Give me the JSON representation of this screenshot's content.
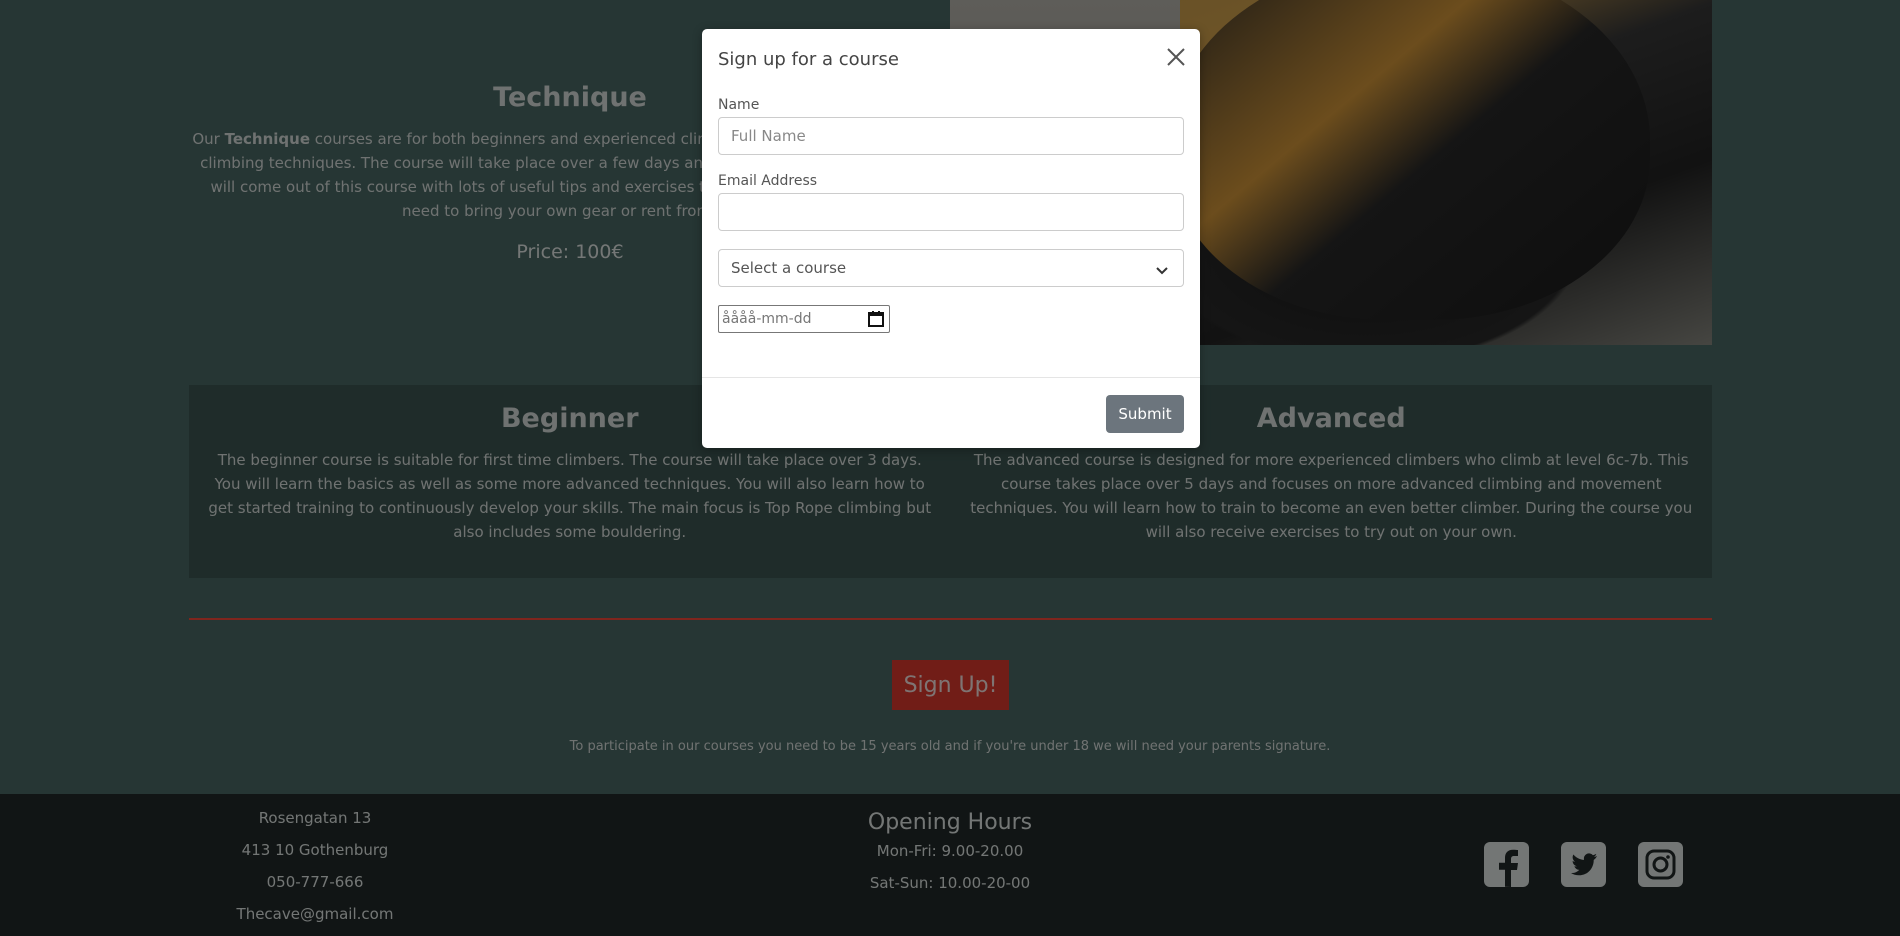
{
  "technique": {
    "title": "Technique",
    "desc_pre": "Our ",
    "desc_bold": "Technique",
    "desc_post": " courses are for both beginners and experienced climbers who want to improve their climbing techniques. The course will take place over a few days and is adapted to your needs. You will come out of this course with lots of useful tips and exercises to practice afterwards. You will need to bring your own gear or rent from us.",
    "price": "Price: 100€"
  },
  "beginner": {
    "title": "Beginner",
    "desc": "The beginner course is suitable for first time climbers. The course will take place over 3 days. You will learn the basics as well as some more advanced techniques. You will also learn how to get started training to continuously develop your skills. The main focus is Top Rope climbing but also includes some bouldering."
  },
  "advanced": {
    "title": "Advanced",
    "desc": "The advanced course is designed for more experienced climbers who climb at level 6c-7b. This course takes place over 5 days and focuses on more advanced climbing and movement techniques. You will learn how to train to become an even better climber. During the course you will also receive exercises to try out on your own."
  },
  "signup_button": "Sign Up!",
  "note": "To participate in our courses you need to be 15 years old and if you're under 18 we will need your parents signature.",
  "footer": {
    "address": [
      "Rosengatan 13",
      "413 10 Gothenburg",
      "050-777-666",
      "Thecave@gmail.com"
    ],
    "hours_title": "Opening Hours",
    "hours": [
      "Mon-Fri: 9.00-20.00",
      "Sat-Sun: 10.00-20-00"
    ],
    "social_icons": [
      "facebook-icon",
      "twitter-icon",
      "instagram-icon"
    ]
  },
  "modal": {
    "title": "Sign up for a course",
    "name_label": "Name",
    "name_placeholder": "Full Name",
    "email_label": "Email Address",
    "email_value": "",
    "course_select": "Select a course",
    "date_placeholder": "åååå-mm-dd",
    "submit_label": "Submit"
  },
  "colors": {
    "background": "#4d6c68",
    "accent_red": "#e33a2e",
    "footer_bg": "#232b2a",
    "submit_gray": "#6c757d"
  }
}
